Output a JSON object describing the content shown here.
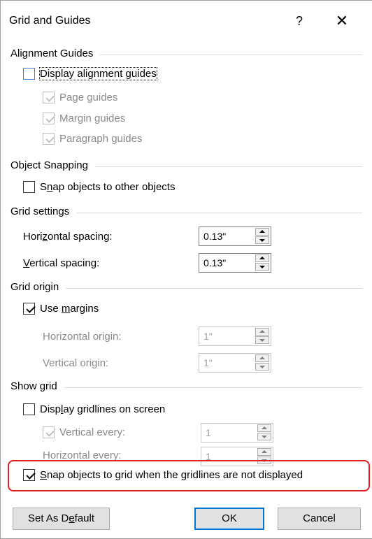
{
  "dialog": {
    "title": "Grid and Guides",
    "help_label": "?",
    "close_label": "✕"
  },
  "alignment": {
    "heading": "Alignment Guides",
    "display_label": "Display alignment guides",
    "display_checked": false,
    "page_guides": "Page guides",
    "margin_guides": "Margin guides",
    "paragraph_guides": "Paragraph guides"
  },
  "snapping": {
    "heading": "Object Snapping",
    "snap_objects_pre": "S",
    "snap_objects_u": "n",
    "snap_objects_post": "ap objects to other objects"
  },
  "grid_settings": {
    "heading": "Grid settings",
    "h_spacing_pre": "Hori",
    "h_spacing_u": "z",
    "h_spacing_post": "ontal spacing:",
    "h_spacing_value": "0.13\"",
    "v_spacing_pre": "",
    "v_spacing_u": "V",
    "v_spacing_post": "ertical spacing:",
    "v_spacing_value": "0.13\""
  },
  "grid_origin": {
    "heading": "Grid origin",
    "use_margins_pre": "Use ",
    "use_margins_u": "m",
    "use_margins_post": "argins",
    "use_margins_checked": true,
    "h_origin_label": "Horizontal origin:",
    "h_origin_value": "1\"",
    "v_origin_label": "Vertical origin:",
    "v_origin_value": "1\""
  },
  "show_grid": {
    "heading": "Show grid",
    "display_pre": "Disp",
    "display_u": "l",
    "display_post": "ay gridlines on screen",
    "display_checked": false,
    "vertical_every_label": "Vertical every:",
    "vertical_every_value": "1",
    "horizontal_every_label": "Horizontal every:",
    "horizontal_every_value": "1"
  },
  "snap_grid": {
    "pre": "",
    "u": "S",
    "post": "nap objects to grid when the gridlines are not displayed",
    "checked": true
  },
  "buttons": {
    "set_default_pre": "Set As D",
    "set_default_u": "e",
    "set_default_post": "fault",
    "ok": "OK",
    "cancel": "Cancel"
  },
  "colors": {
    "highlight": "#e02020",
    "accent": "#0078d7"
  }
}
